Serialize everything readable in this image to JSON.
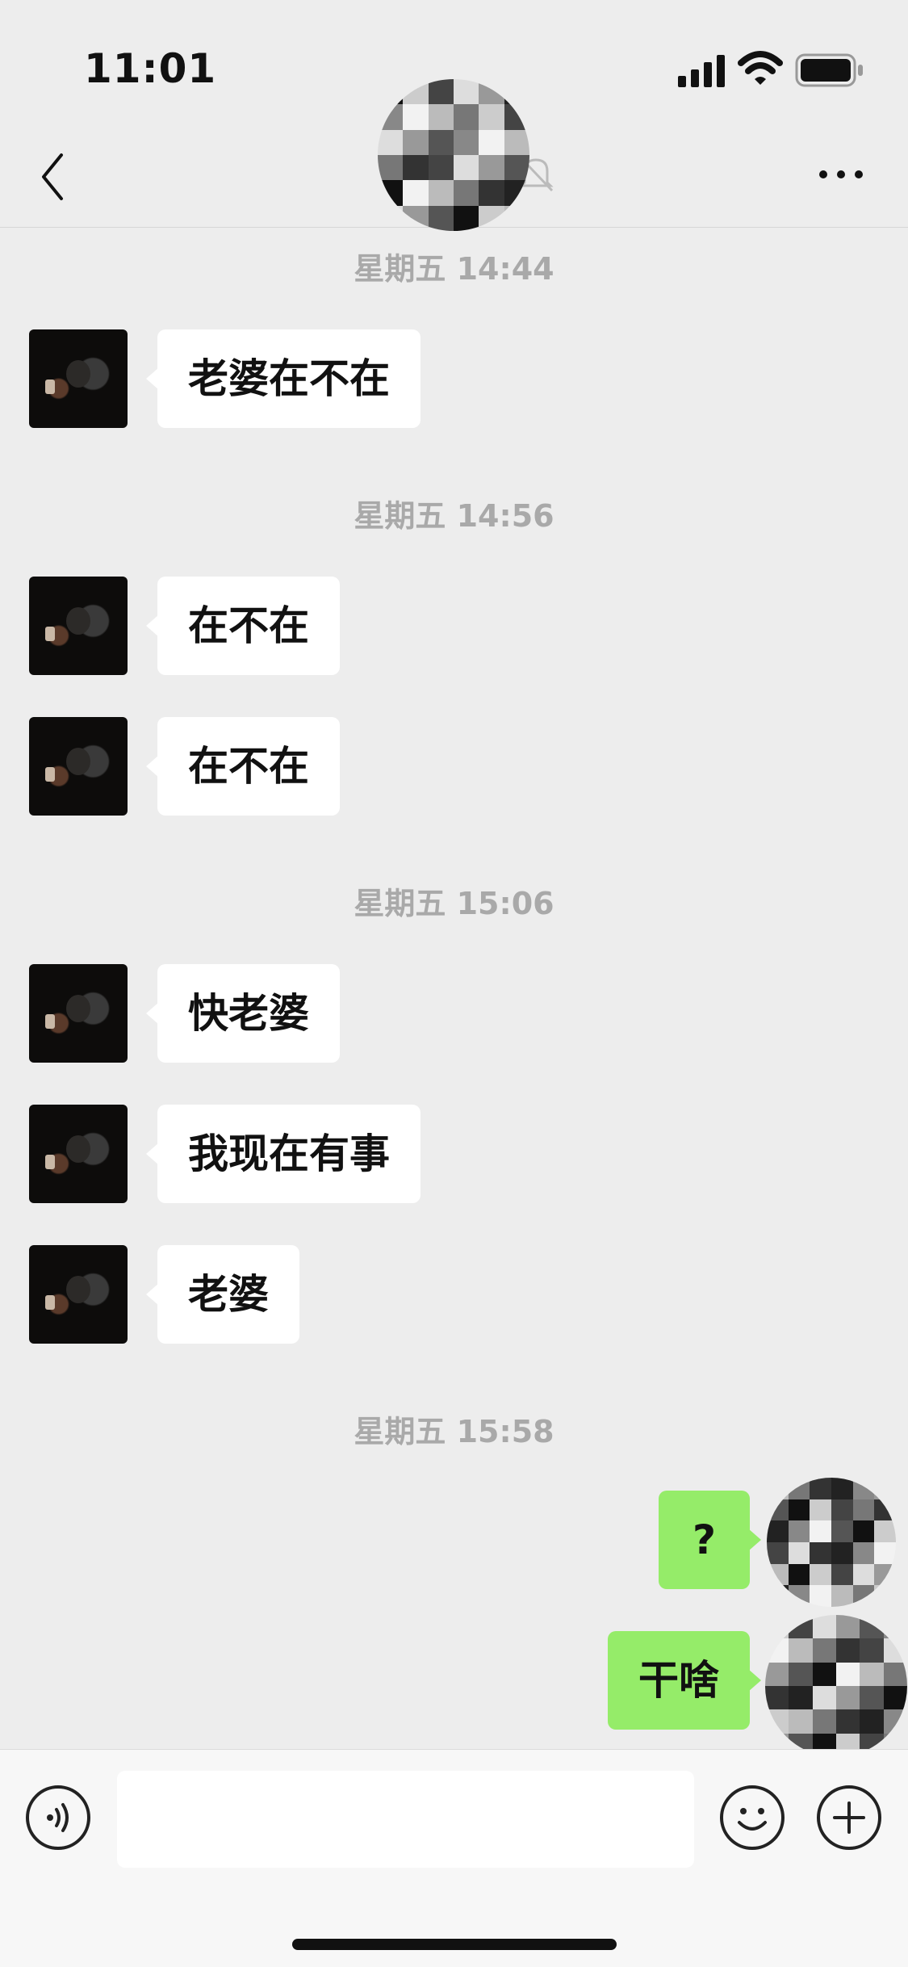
{
  "status_bar": {
    "time": "11:01"
  },
  "nav": {
    "contact_name": ""
  },
  "messages": [
    {
      "type": "timestamp",
      "text": "星期五 14:44"
    },
    {
      "type": "in",
      "text": "老婆在不在"
    },
    {
      "type": "timestamp",
      "text": "星期五 14:56"
    },
    {
      "type": "in",
      "text": "在不在"
    },
    {
      "type": "in",
      "text": "在不在"
    },
    {
      "type": "timestamp",
      "text": "星期五 15:06"
    },
    {
      "type": "in",
      "text": "快老婆"
    },
    {
      "type": "in",
      "text": "我现在有事"
    },
    {
      "type": "in",
      "text": "老婆"
    },
    {
      "type": "timestamp",
      "text": "星期五 15:58"
    },
    {
      "type": "out",
      "text": "?"
    },
    {
      "type": "out",
      "text": "干啥"
    }
  ],
  "input": {
    "value": ""
  },
  "colors": {
    "background": "#ededed",
    "incoming_bubble": "#ffffff",
    "outgoing_bubble": "#95ec69",
    "timestamp": "#a9a9a9"
  },
  "icons": {
    "back": "chevron-left",
    "more": "ellipsis",
    "mute": "bell-slash",
    "voice": "voice-wave",
    "emoji": "smiley",
    "plus": "plus-circle"
  }
}
